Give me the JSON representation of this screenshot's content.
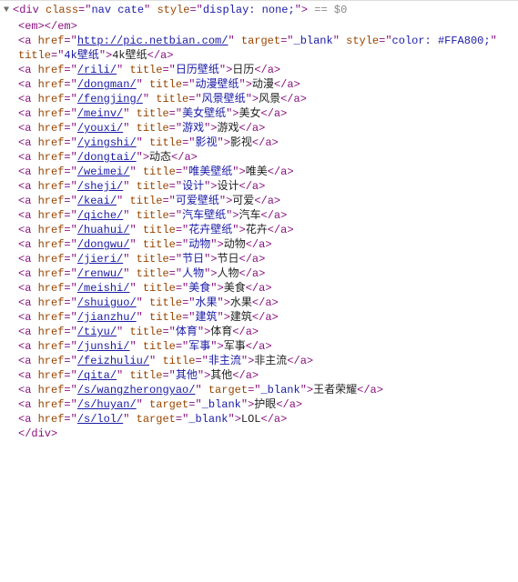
{
  "openingLine": {
    "toggle": "▼",
    "open": "<",
    "tag": "div",
    "attrs": [
      {
        "name": "class",
        "eq": "=\"",
        "val": "nav cate",
        "end": "\""
      },
      {
        "name": "style",
        "eq": "=\"",
        "val": "display: none;",
        "end": "\""
      }
    ],
    "close": ">",
    "console": " == $0"
  },
  "emLine": {
    "raw": "<em></em>"
  },
  "anchors": [
    {
      "href": "http://pic.netbian.com/",
      "linkStyle": true,
      "target": "_blank",
      "style": "color: #FFA800;",
      "titleAttr": "4k壁纸",
      "text": "4k壁纸"
    },
    {
      "href": "/rili/",
      "linkStyle": true,
      "titleAttr": "日历壁纸",
      "text": "日历"
    },
    {
      "href": "/dongman/",
      "linkStyle": true,
      "titleAttr": "动漫壁纸",
      "text": "动漫"
    },
    {
      "href": "/fengjing/",
      "linkStyle": true,
      "titleAttr": "风景壁纸",
      "text": "风景"
    },
    {
      "href": "/meinv/",
      "linkStyle": true,
      "titleAttr": "美女壁纸",
      "text": "美女"
    },
    {
      "href": "/youxi/",
      "linkStyle": true,
      "titleAttr": "游戏",
      "text": "游戏"
    },
    {
      "href": "/yingshi/",
      "linkStyle": true,
      "titleAttr": "影视",
      "text": "影视"
    },
    {
      "href": "/dongtai/",
      "linkStyle": true,
      "text": "动态"
    },
    {
      "href": "/weimei/",
      "linkStyle": true,
      "titleAttr": "唯美壁纸",
      "text": "唯美"
    },
    {
      "href": "/sheji/",
      "linkStyle": true,
      "titleAttr": "设计",
      "text": "设计"
    },
    {
      "href": "/keai/",
      "linkStyle": true,
      "titleAttr": "可爱壁纸",
      "text": "可爱"
    },
    {
      "href": "/qiche/",
      "linkStyle": true,
      "titleAttr": "汽车壁纸",
      "text": "汽车"
    },
    {
      "href": "/huahui/",
      "linkStyle": true,
      "titleAttr": "花卉壁纸",
      "text": "花卉"
    },
    {
      "href": "/dongwu/",
      "linkStyle": true,
      "titleAttr": "动物",
      "text": "动物"
    },
    {
      "href": "/jieri/",
      "linkStyle": true,
      "titleAttr": "节日",
      "text": "节日"
    },
    {
      "href": "/renwu/",
      "linkStyle": true,
      "titleAttr": "人物",
      "text": "人物"
    },
    {
      "href": "/meishi/",
      "linkStyle": true,
      "titleAttr": "美食",
      "text": "美食"
    },
    {
      "href": "/shuiguo/",
      "linkStyle": true,
      "titleAttr": "水果",
      "text": "水果"
    },
    {
      "href": "/jianzhu/",
      "linkStyle": true,
      "titleAttr": "建筑",
      "text": "建筑"
    },
    {
      "href": "/tiyu/",
      "linkStyle": true,
      "titleAttr": "体育",
      "text": "体育"
    },
    {
      "href": "/junshi/",
      "linkStyle": true,
      "titleAttr": "军事",
      "text": "军事"
    },
    {
      "href": "/feizhuliu/",
      "linkStyle": true,
      "titleAttr": "非主流",
      "text": "非主流"
    },
    {
      "href": "/qita/",
      "linkStyle": true,
      "titleAttr": "其他",
      "text": "其他"
    },
    {
      "href": "/s/wangzherongyao/",
      "linkStyle": true,
      "target": "_blank",
      "text": "王者荣耀"
    },
    {
      "href": "/s/huyan/",
      "linkStyle": true,
      "target": "_blank",
      "text": "护眼"
    },
    {
      "href": "/s/lol/",
      "linkStyle": true,
      "target": "_blank",
      "text": "LOL"
    }
  ],
  "closingLine": {
    "raw": "</div>"
  }
}
